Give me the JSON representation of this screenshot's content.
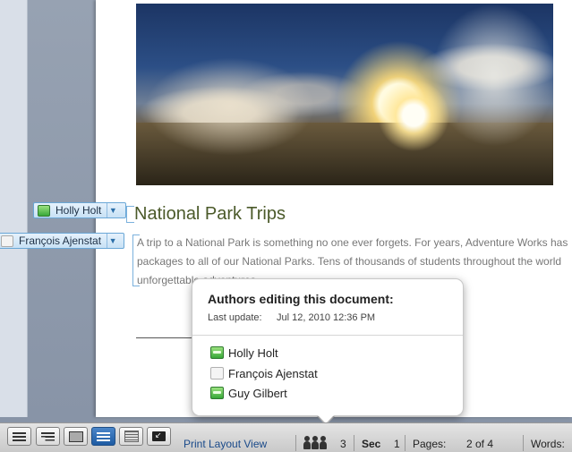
{
  "document": {
    "title": "National Park Trips",
    "body_lines": [
      "A trip to a National Park is something no one ever forgets. For years, Adventure Works has",
      "packages to all of our National Parks. Tens of thousands of students throughout the world",
      "unforgettable adventures."
    ]
  },
  "author_tags": [
    {
      "name": "Holly Holt",
      "active": true
    },
    {
      "name": "François Ajenstat",
      "active": false
    }
  ],
  "popover": {
    "title": "Authors editing this document:",
    "last_update_label": "Last update:",
    "last_update_value": "Jul 12, 2010 12:36 PM",
    "authors": [
      {
        "name": "Holly Holt",
        "editing": true
      },
      {
        "name": "François Ajenstat",
        "editing": false
      },
      {
        "name": "Guy Gilbert",
        "editing": true
      }
    ]
  },
  "statusbar": {
    "view_label": "Print Layout View",
    "authors_count": "3",
    "sec_label": "Sec",
    "sec_value": "1",
    "pages_label": "Pages:",
    "pages_value": "2 of 4",
    "words_label": "Words:"
  },
  "icons": {
    "view_buttons": [
      "draft-view-icon",
      "outline-view-icon",
      "publishing-layout-icon",
      "print-layout-icon",
      "notebook-layout-icon",
      "full-screen-icon"
    ],
    "authors": "people-icon"
  },
  "colors": {
    "accent": "#1d5ba3",
    "author_active": "#38a838",
    "tag_border": "#6aa7d6"
  }
}
